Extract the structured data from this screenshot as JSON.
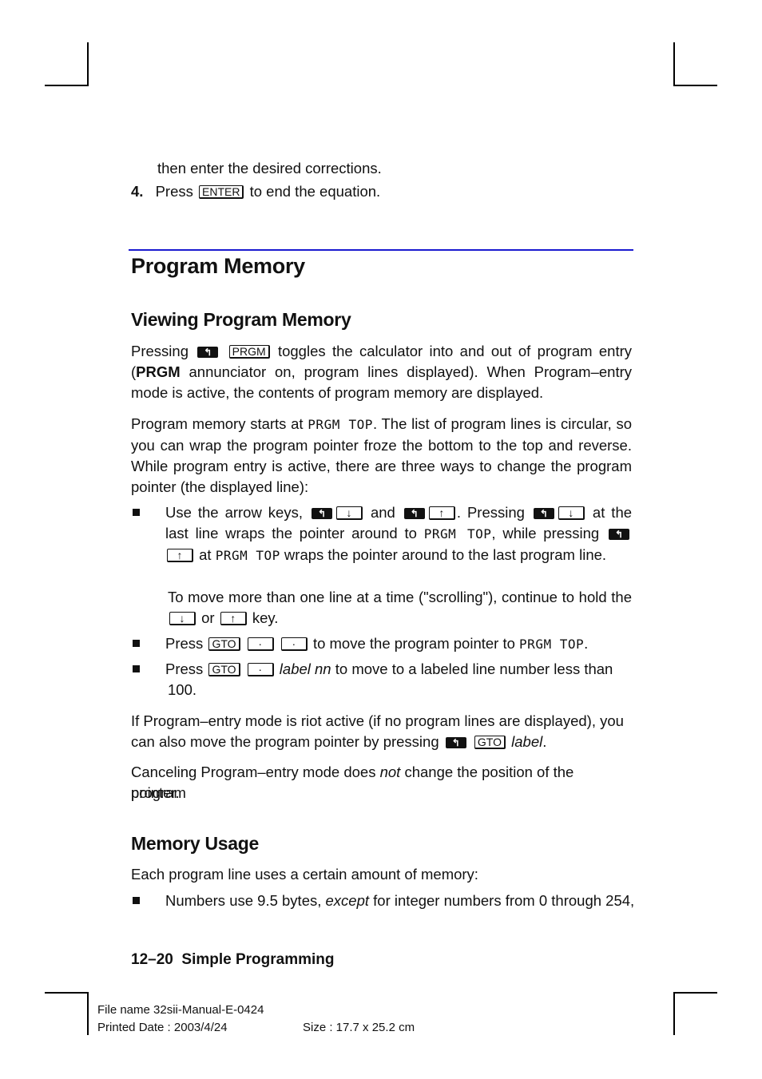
{
  "page": {
    "intro": {
      "continuation": "then enter the desired corrections.",
      "step4_num": "4.",
      "step4_pre": "Press",
      "step4_key": "ENTER",
      "step4_post": "to end the equation."
    },
    "title": "Program Memory",
    "section1": {
      "heading": "Viewing Program Memory",
      "p1": {
        "pre": "Pressing",
        "shift_icon": "left-shift-icon",
        "key": "PRGM",
        "post1": "toggles the calculator into and out of program entry (",
        "bold": "PRGM",
        "post2": " annunciator on, program lines displayed). When Program–entry mode is active, the contents of program memory are displayed."
      },
      "p2": {
        "pre": "Program memory starts at ",
        "display": "PRGM TOP",
        "post": ". The list of program lines is circular, so you can wrap the program pointer froze the bottom to the top and reverse. While program entry is active, there are three ways to change the program pointer (the displayed line):"
      },
      "bullets": {
        "b1": {
          "t1": "Use the arrow keys,",
          "down": "↓",
          "t2": "and",
          "up": "↑",
          "t3": ". Pressing",
          "t4": "at the",
          "t5": "last line wraps the pointer around to",
          "display": "PRGM TOP",
          "t6": ", while pressing",
          "t7": "at",
          "t8": "wraps the pointer around to the last program line.",
          "scroll1": "To move more than one line at a time (\"scrolling\"), continue to hold the",
          "or": "or",
          "key_word": "key."
        },
        "b2": {
          "pre": "Press",
          "key": "GTO",
          "dot": "·",
          "post": "to move the program pointer to",
          "display": "PRGM TOP",
          "end": "."
        },
        "b3": {
          "pre": "Press",
          "key": "GTO",
          "dot": "·",
          "italic": "label nn",
          "post": "to move to a labeled line number less than",
          "line2": "100."
        }
      },
      "p3": {
        "line1": "If Program–entry mode is riot active (if no program lines are displayed), you",
        "pre": "can also move the program pointer by pressing",
        "key": "GTO",
        "italic": "label",
        "end": "."
      },
      "p4": {
        "pre": "Canceling Program–entry mode does ",
        "italic": "not",
        "post": " change the position of the program",
        "line2": "pointer."
      }
    },
    "section2": {
      "heading": "Memory Usage",
      "p1": "Each program line uses a certain amount of memory:",
      "bullet": {
        "pre": "Numbers use 9.5 bytes, ",
        "italic": "except",
        "post": " for integer numbers from 0 through 254,"
      }
    },
    "running_footer": "12–20  Simple Programming",
    "print_info": {
      "file_name": "File name 32sii-Manual-E-0424",
      "printed_date": "Printed Date : 2003/4/24",
      "size": "Size : 17.7 x 25.2 cm"
    }
  }
}
